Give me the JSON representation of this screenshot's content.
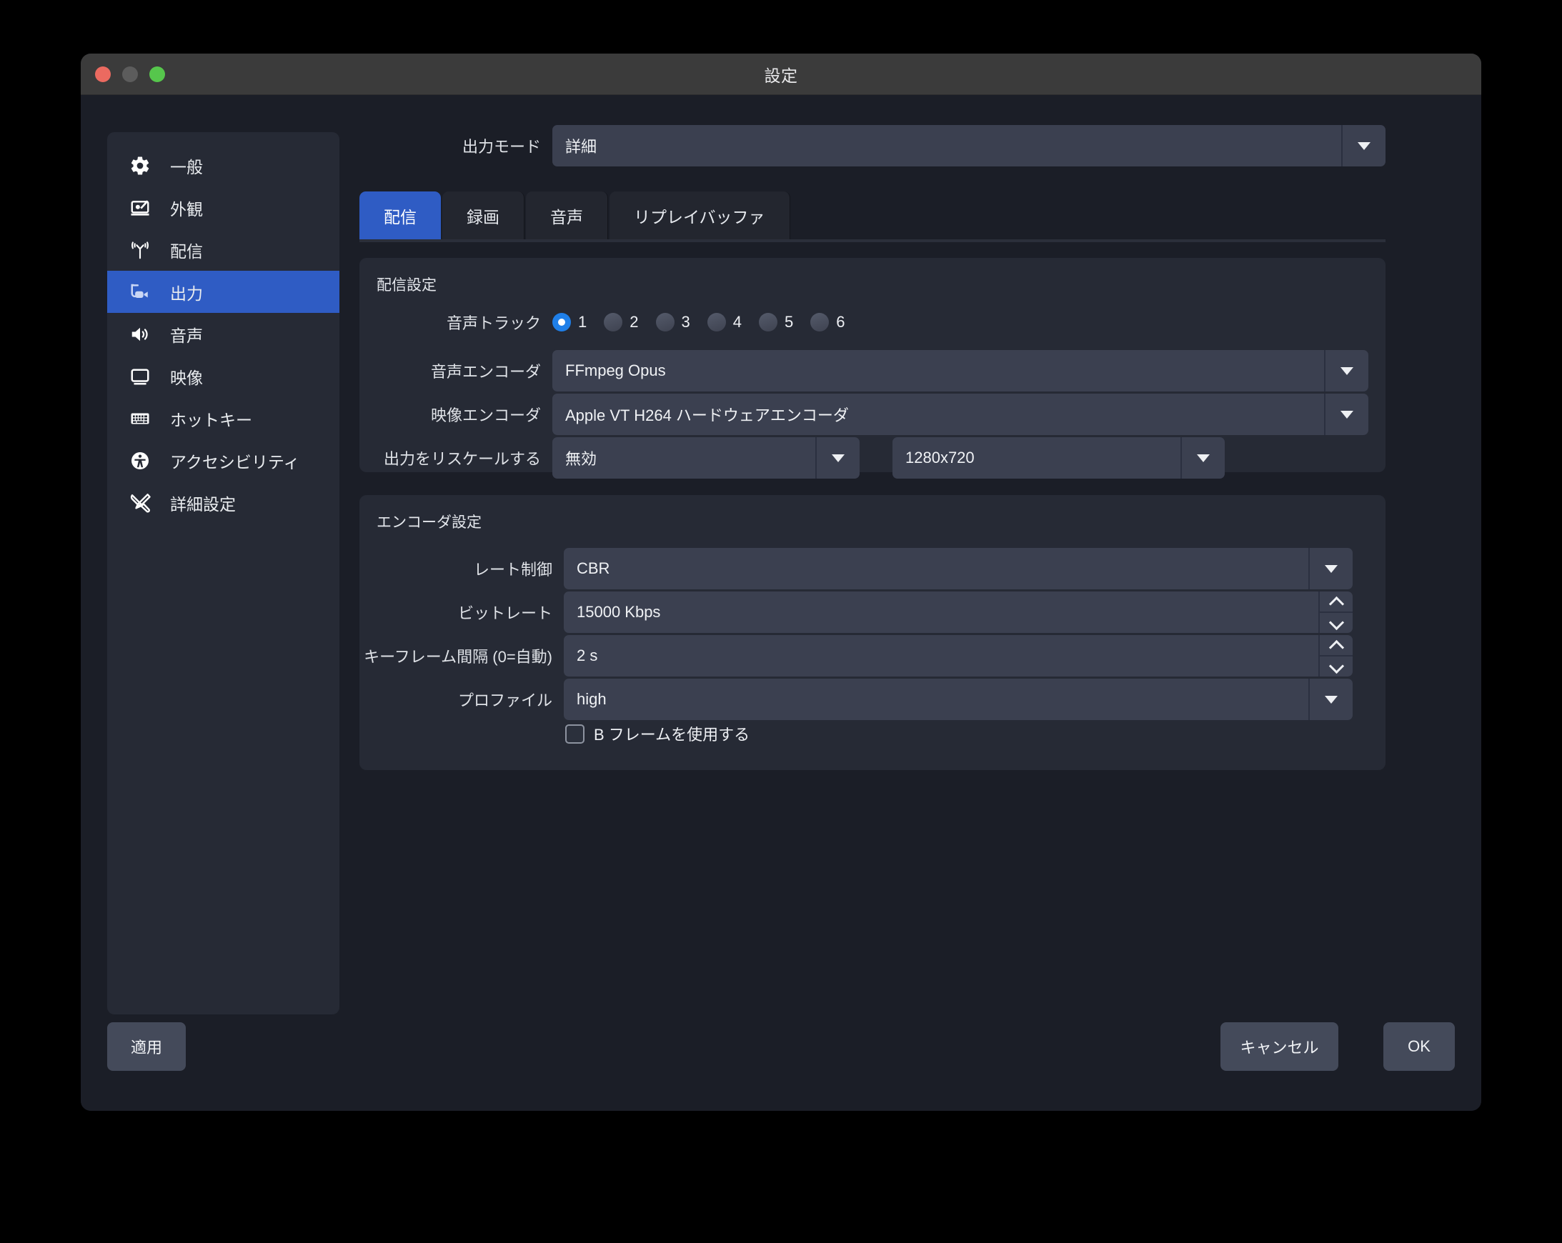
{
  "window": {
    "title": "設定",
    "traffic_lights": [
      "close",
      "minimize",
      "zoom"
    ]
  },
  "sidebar": {
    "items": [
      {
        "icon": "gear-icon",
        "label": "一般",
        "active": false
      },
      {
        "icon": "appearance-icon",
        "label": "外観",
        "active": false
      },
      {
        "icon": "broadcast-icon",
        "label": "配信",
        "active": false
      },
      {
        "icon": "output-camera-icon",
        "label": "出力",
        "active": true
      },
      {
        "icon": "speaker-icon",
        "label": "音声",
        "active": false
      },
      {
        "icon": "monitor-icon",
        "label": "映像",
        "active": false
      },
      {
        "icon": "keyboard-icon",
        "label": "ホットキー",
        "active": false
      },
      {
        "icon": "accessibility-icon",
        "label": "アクセシビリティ",
        "active": false
      },
      {
        "icon": "tools-icon",
        "label": "詳細設定",
        "active": false
      }
    ]
  },
  "output_mode": {
    "label": "出力モード",
    "value": "詳細"
  },
  "tabs": [
    {
      "label": "配信",
      "active": true
    },
    {
      "label": "録画",
      "active": false
    },
    {
      "label": "音声",
      "active": false
    },
    {
      "label": "リプレイバッファ",
      "active": false
    }
  ],
  "stream_group": {
    "title": "配信設定",
    "audio_track": {
      "label": "音声トラック",
      "options": [
        "1",
        "2",
        "3",
        "4",
        "5",
        "6"
      ],
      "selected": "1"
    },
    "audio_encoder": {
      "label": "音声エンコーダ",
      "value": "FFmpeg Opus"
    },
    "video_encoder": {
      "label": "映像エンコーダ",
      "value": "Apple VT H264 ハードウェアエンコーダ"
    },
    "rescale": {
      "label": "出力をリスケールする",
      "mode_value": "無効",
      "resolution_value": "1280x720"
    }
  },
  "encoder_group": {
    "title": "エンコーダ設定",
    "rate_control": {
      "label": "レート制御",
      "value": "CBR"
    },
    "bitrate": {
      "label": "ビットレート",
      "value": "15000 Kbps"
    },
    "keyframe_interval": {
      "label": "キーフレーム間隔 (0=自動)",
      "value": "2 s"
    },
    "profile": {
      "label": "プロファイル",
      "value": "high"
    },
    "b_frames": {
      "label": "B フレームを使用する",
      "checked": false
    }
  },
  "footer": {
    "apply": "適用",
    "cancel": "キャンセル",
    "ok": "OK"
  },
  "colors": {
    "accent": "#2f5cc4",
    "window_bg": "#1b1e27",
    "panel_bg": "#262a35",
    "field_bg": "#3b4050",
    "titlebar_bg": "#3b3b3b",
    "radio_on": "#1f7fe8",
    "close": "#eb6a60",
    "minimize": "#5c5c5c",
    "zoom": "#56c64c"
  }
}
